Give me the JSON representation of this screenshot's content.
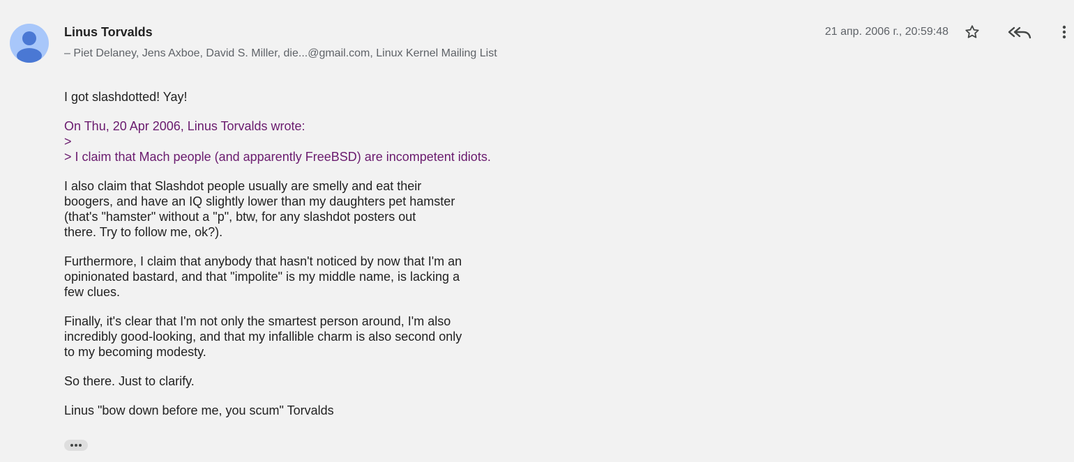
{
  "message": {
    "sender": "Linus Torvalds",
    "recipients": "– Piet Delaney, Jens Axboe, David S. Miller, die...@gmail.com, Linux Kernel Mailing List",
    "date": "21 апр. 2006 г., 20:59:48",
    "avatar_icon": "person-icon",
    "body": {
      "greeting": "I got slashdotted! Yay!",
      "quote": "On Thu, 20 Apr 2006, Linus Torvalds wrote:\n>\n> I claim that Mach people (and apparently FreeBSD) are incompetent idiots.",
      "paragraphs": [
        "I also claim that Slashdot people usually are smelly and eat their\nboogers, and have an IQ slightly lower than my daughters pet hamster\n(that's \"hamster\" without a \"p\", btw, for any slashdot posters out\nthere. Try to follow me, ok?).",
        "Furthermore, I claim that anybody that hasn't noticed by now that I'm an\nopinionated bastard, and that \"impolite\" is my middle name, is lacking a\nfew clues.",
        "Finally, it's clear that I'm not only the smartest person around, I'm also\nincredibly good-looking, and that my infallible charm is also second only\nto my becoming modesty.",
        "So there. Just to clarify.",
        "Linus \"bow down before me, you scum\" Torvalds"
      ]
    }
  },
  "actions": {
    "star_icon": "star-icon",
    "reply_all_icon": "reply-all-icon",
    "more_icon": "more-vertical-icon",
    "expand_icon": "ellipsis-icon"
  },
  "colors": {
    "background": "#f2f2f2",
    "quote": "#6a1b6e",
    "avatar_bg": "#a8c7fa",
    "avatar_fg": "#4a78d4",
    "icon": "#444746"
  }
}
